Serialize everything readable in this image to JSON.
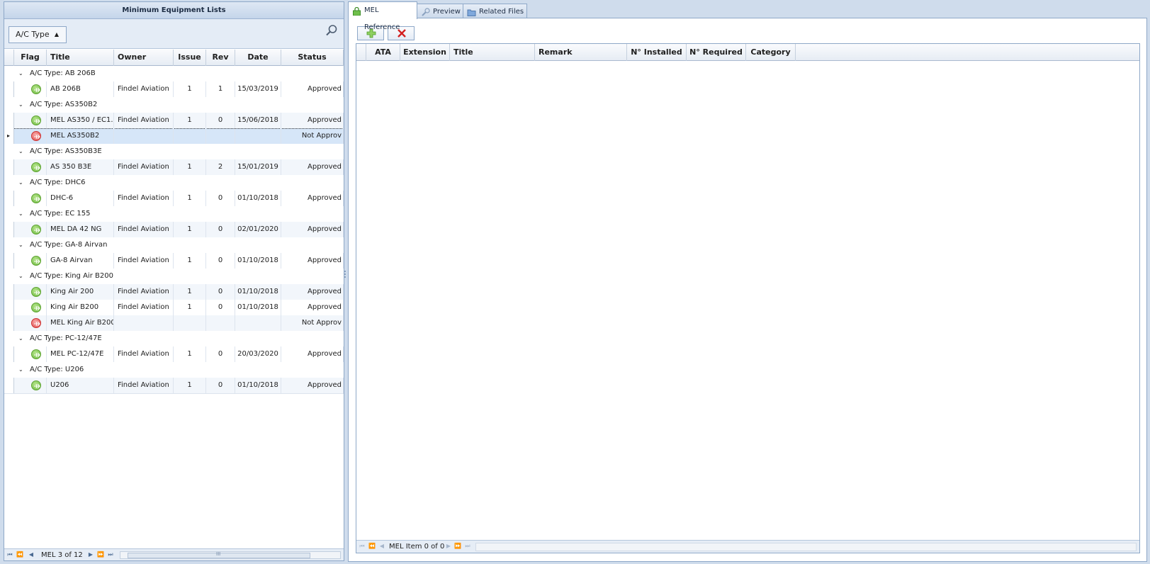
{
  "left_panel": {
    "title": "Minimum Equipment Lists",
    "group_chip": "A/C Type",
    "columns": [
      "Flag",
      "Title",
      "Owner",
      "Issue",
      "Rev",
      "Date",
      "Status"
    ],
    "groups": [
      {
        "label": "A/C Type: AB 206B",
        "rows": [
          {
            "flag": "green",
            "title": "AB 206B",
            "owner": "Findel Aviation",
            "issue": "1",
            "rev": "1",
            "date": "15/03/2019",
            "status": "Approved"
          }
        ]
      },
      {
        "label": "A/C Type: AS350B2",
        "rows": [
          {
            "flag": "green",
            "title": "MEL AS350 / EC1...",
            "owner": "Findel Aviation",
            "issue": "1",
            "rev": "0",
            "date": "15/06/2018",
            "status": "Approved"
          },
          {
            "flag": "red",
            "title": "MEL AS350B2",
            "owner": "",
            "issue": "",
            "rev": "",
            "date": "",
            "status": "Not Approv",
            "selected": true
          }
        ]
      },
      {
        "label": "A/C Type: AS350B3E",
        "rows": [
          {
            "flag": "green",
            "title": "AS 350 B3E",
            "owner": "Findel Aviation",
            "issue": "1",
            "rev": "2",
            "date": "15/01/2019",
            "status": "Approved"
          }
        ]
      },
      {
        "label": "A/C Type: DHC6",
        "rows": [
          {
            "flag": "green",
            "title": "DHC-6",
            "owner": "Findel Aviation",
            "issue": "1",
            "rev": "0",
            "date": "01/10/2018",
            "status": "Approved"
          }
        ]
      },
      {
        "label": "A/C Type: EC 155",
        "rows": [
          {
            "flag": "green",
            "title": "MEL DA 42 NG",
            "owner": "Findel Aviation",
            "issue": "1",
            "rev": "0",
            "date": "02/01/2020",
            "status": "Approved"
          }
        ]
      },
      {
        "label": "A/C Type: GA-8 Airvan",
        "rows": [
          {
            "flag": "green",
            "title": "GA-8 Airvan",
            "owner": "Findel Aviation",
            "issue": "1",
            "rev": "0",
            "date": "01/10/2018",
            "status": "Approved"
          }
        ]
      },
      {
        "label": "A/C Type: King Air B200",
        "rows": [
          {
            "flag": "green",
            "title": " King Air 200",
            "owner": "Findel Aviation",
            "issue": "1",
            "rev": "0",
            "date": "01/10/2018",
            "status": "Approved"
          },
          {
            "flag": "green",
            "title": "King Air B200",
            "owner": "Findel Aviation",
            "issue": "1",
            "rev": "0",
            "date": "01/10/2018",
            "status": "Approved"
          },
          {
            "flag": "red",
            "title": "MEL King Air B200",
            "owner": "",
            "issue": "",
            "rev": "",
            "date": "",
            "status": "Not Approv"
          }
        ]
      },
      {
        "label": "A/C Type: PC-12/47E",
        "rows": [
          {
            "flag": "green",
            "title": "MEL PC-12/47E",
            "owner": "Findel Aviation",
            "issue": "1",
            "rev": "0",
            "date": "20/03/2020",
            "status": "Approved"
          }
        ]
      },
      {
        "label": "A/C Type: U206",
        "rows": [
          {
            "flag": "green",
            "title": "U206",
            "owner": "Findel Aviation",
            "issue": "1",
            "rev": "0",
            "date": "01/10/2018",
            "status": "Approved"
          }
        ]
      }
    ],
    "footer_count": "MEL 3 of 12",
    "scroll_grip": "III"
  },
  "tabs": [
    {
      "label": "MEL Reference",
      "icon": "lock-icon",
      "active": true
    },
    {
      "label": "Preview",
      "icon": "magnifier-icon",
      "active": false
    },
    {
      "label": "Related Files",
      "icon": "folder-icon",
      "active": false
    }
  ],
  "right_panel": {
    "toolbar": {
      "add_icon": "plus-icon",
      "delete_icon": "x-icon"
    },
    "columns": [
      "ATA",
      "Extension",
      "Title",
      "Remark",
      "N° Installed",
      "N° Required",
      "Category"
    ],
    "footer_count": "MEL Item 0 of 0"
  },
  "colors": {
    "flag_green": "#6ab83b",
    "flag_red": "#e04848",
    "accent": "#8ea8c8"
  }
}
